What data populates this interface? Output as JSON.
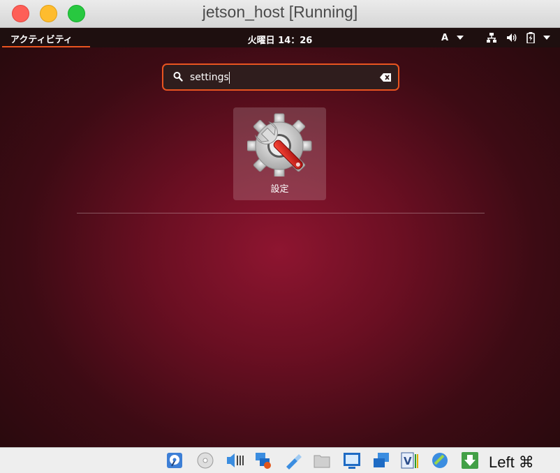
{
  "window": {
    "title": "jetson_host [Running]"
  },
  "topbar": {
    "activities_label": "アクティビティ",
    "clock": "火曜日 14：26",
    "input_method": "A"
  },
  "search": {
    "value": "settings",
    "placeholder": ""
  },
  "results": [
    {
      "label": "設定"
    }
  ],
  "statusbar": {
    "host_key": "Left ⌘"
  },
  "colors": {
    "accent": "#e95420",
    "topbar": "#1e0f0f"
  }
}
